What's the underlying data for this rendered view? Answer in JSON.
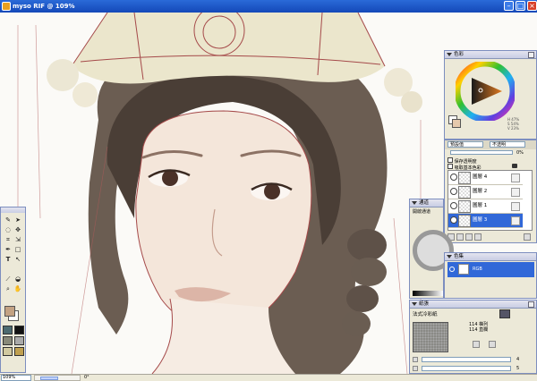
{
  "window": {
    "title": "myso RIF @ 109%"
  },
  "status_bar": {
    "zoom": "109%",
    "angle": "0°"
  },
  "colors": {
    "accent": "#3168d8",
    "brush_main": "#c3a283",
    "brush_sub": "#ffffff"
  },
  "tools": {
    "icons": [
      "brush-icon",
      "selection-arrow-icon",
      "lasso-icon",
      "move-icon",
      "crop-icon",
      "transform-icon",
      "pen-icon",
      "rectangle-icon",
      "text-icon",
      "direct-select-icon",
      "eyedropper-icon",
      "bucket-icon",
      "zoom-icon",
      "hand-icon"
    ]
  },
  "color_panel": {
    "title": "色彩",
    "readout": [
      "H 47%",
      "S 54%",
      "V 23%"
    ]
  },
  "layers_panel": {
    "composite_method": "預設值",
    "opacity_label": "不透明",
    "opacity_value": "0%",
    "preserve_transparency": "保存透明度",
    "pick_up_underlying_color": "吸取基本色彩",
    "layers": [
      {
        "name": "圖層 4",
        "selected": false
      },
      {
        "name": "圖層 2",
        "selected": false
      },
      {
        "name": "圖層 1",
        "selected": false
      },
      {
        "name": "圖層 3",
        "selected": true
      }
    ]
  },
  "channels_panel": {
    "title": "通道",
    "subtitle": "開啟通道"
  },
  "color_set_panel": {
    "title": "色集",
    "item": "RGB"
  },
  "paper_panel": {
    "title": "紙張",
    "paper_name": "法式冷彩紙",
    "scale_label": "114 橫列",
    "contrast_label": "114 直欄",
    "scale_value": "4",
    "contrast_value": "5"
  }
}
